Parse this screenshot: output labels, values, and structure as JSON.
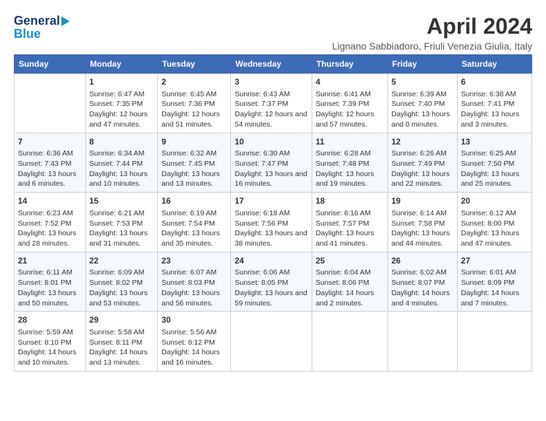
{
  "header": {
    "logo_line1": "General",
    "logo_line2": "Blue",
    "title": "April 2024",
    "subtitle": "Lignano Sabbiadoro, Friuli Venezia Giulia, Italy"
  },
  "columns": [
    "Sunday",
    "Monday",
    "Tuesday",
    "Wednesday",
    "Thursday",
    "Friday",
    "Saturday"
  ],
  "weeks": [
    [
      {
        "day": "",
        "sunrise": "",
        "sunset": "",
        "daylight": ""
      },
      {
        "day": "1",
        "sunrise": "Sunrise: 6:47 AM",
        "sunset": "Sunset: 7:35 PM",
        "daylight": "Daylight: 12 hours and 47 minutes."
      },
      {
        "day": "2",
        "sunrise": "Sunrise: 6:45 AM",
        "sunset": "Sunset: 7:36 PM",
        "daylight": "Daylight: 12 hours and 51 minutes."
      },
      {
        "day": "3",
        "sunrise": "Sunrise: 6:43 AM",
        "sunset": "Sunset: 7:37 PM",
        "daylight": "Daylight: 12 hours and 54 minutes."
      },
      {
        "day": "4",
        "sunrise": "Sunrise: 6:41 AM",
        "sunset": "Sunset: 7:39 PM",
        "daylight": "Daylight: 12 hours and 57 minutes."
      },
      {
        "day": "5",
        "sunrise": "Sunrise: 6:39 AM",
        "sunset": "Sunset: 7:40 PM",
        "daylight": "Daylight: 13 hours and 0 minutes."
      },
      {
        "day": "6",
        "sunrise": "Sunrise: 6:38 AM",
        "sunset": "Sunset: 7:41 PM",
        "daylight": "Daylight: 13 hours and 3 minutes."
      }
    ],
    [
      {
        "day": "7",
        "sunrise": "Sunrise: 6:36 AM",
        "sunset": "Sunset: 7:43 PM",
        "daylight": "Daylight: 13 hours and 6 minutes."
      },
      {
        "day": "8",
        "sunrise": "Sunrise: 6:34 AM",
        "sunset": "Sunset: 7:44 PM",
        "daylight": "Daylight: 13 hours and 10 minutes."
      },
      {
        "day": "9",
        "sunrise": "Sunrise: 6:32 AM",
        "sunset": "Sunset: 7:45 PM",
        "daylight": "Daylight: 13 hours and 13 minutes."
      },
      {
        "day": "10",
        "sunrise": "Sunrise: 6:30 AM",
        "sunset": "Sunset: 7:47 PM",
        "daylight": "Daylight: 13 hours and 16 minutes."
      },
      {
        "day": "11",
        "sunrise": "Sunrise: 6:28 AM",
        "sunset": "Sunset: 7:48 PM",
        "daylight": "Daylight: 13 hours and 19 minutes."
      },
      {
        "day": "12",
        "sunrise": "Sunrise: 6:26 AM",
        "sunset": "Sunset: 7:49 PM",
        "daylight": "Daylight: 13 hours and 22 minutes."
      },
      {
        "day": "13",
        "sunrise": "Sunrise: 6:25 AM",
        "sunset": "Sunset: 7:50 PM",
        "daylight": "Daylight: 13 hours and 25 minutes."
      }
    ],
    [
      {
        "day": "14",
        "sunrise": "Sunrise: 6:23 AM",
        "sunset": "Sunset: 7:52 PM",
        "daylight": "Daylight: 13 hours and 28 minutes."
      },
      {
        "day": "15",
        "sunrise": "Sunrise: 6:21 AM",
        "sunset": "Sunset: 7:53 PM",
        "daylight": "Daylight: 13 hours and 31 minutes."
      },
      {
        "day": "16",
        "sunrise": "Sunrise: 6:19 AM",
        "sunset": "Sunset: 7:54 PM",
        "daylight": "Daylight: 13 hours and 35 minutes."
      },
      {
        "day": "17",
        "sunrise": "Sunrise: 6:18 AM",
        "sunset": "Sunset: 7:56 PM",
        "daylight": "Daylight: 13 hours and 38 minutes."
      },
      {
        "day": "18",
        "sunrise": "Sunrise: 6:16 AM",
        "sunset": "Sunset: 7:57 PM",
        "daylight": "Daylight: 13 hours and 41 minutes."
      },
      {
        "day": "19",
        "sunrise": "Sunrise: 6:14 AM",
        "sunset": "Sunset: 7:58 PM",
        "daylight": "Daylight: 13 hours and 44 minutes."
      },
      {
        "day": "20",
        "sunrise": "Sunrise: 6:12 AM",
        "sunset": "Sunset: 8:00 PM",
        "daylight": "Daylight: 13 hours and 47 minutes."
      }
    ],
    [
      {
        "day": "21",
        "sunrise": "Sunrise: 6:11 AM",
        "sunset": "Sunset: 8:01 PM",
        "daylight": "Daylight: 13 hours and 50 minutes."
      },
      {
        "day": "22",
        "sunrise": "Sunrise: 6:09 AM",
        "sunset": "Sunset: 8:02 PM",
        "daylight": "Daylight: 13 hours and 53 minutes."
      },
      {
        "day": "23",
        "sunrise": "Sunrise: 6:07 AM",
        "sunset": "Sunset: 8:03 PM",
        "daylight": "Daylight: 13 hours and 56 minutes."
      },
      {
        "day": "24",
        "sunrise": "Sunrise: 6:06 AM",
        "sunset": "Sunset: 8:05 PM",
        "daylight": "Daylight: 13 hours and 59 minutes."
      },
      {
        "day": "25",
        "sunrise": "Sunrise: 6:04 AM",
        "sunset": "Sunset: 8:06 PM",
        "daylight": "Daylight: 14 hours and 2 minutes."
      },
      {
        "day": "26",
        "sunrise": "Sunrise: 6:02 AM",
        "sunset": "Sunset: 8:07 PM",
        "daylight": "Daylight: 14 hours and 4 minutes."
      },
      {
        "day": "27",
        "sunrise": "Sunrise: 6:01 AM",
        "sunset": "Sunset: 8:09 PM",
        "daylight": "Daylight: 14 hours and 7 minutes."
      }
    ],
    [
      {
        "day": "28",
        "sunrise": "Sunrise: 5:59 AM",
        "sunset": "Sunset: 8:10 PM",
        "daylight": "Daylight: 14 hours and 10 minutes."
      },
      {
        "day": "29",
        "sunrise": "Sunrise: 5:58 AM",
        "sunset": "Sunset: 8:11 PM",
        "daylight": "Daylight: 14 hours and 13 minutes."
      },
      {
        "day": "30",
        "sunrise": "Sunrise: 5:56 AM",
        "sunset": "Sunset: 8:12 PM",
        "daylight": "Daylight: 14 hours and 16 minutes."
      },
      {
        "day": "",
        "sunrise": "",
        "sunset": "",
        "daylight": ""
      },
      {
        "day": "",
        "sunrise": "",
        "sunset": "",
        "daylight": ""
      },
      {
        "day": "",
        "sunrise": "",
        "sunset": "",
        "daylight": ""
      },
      {
        "day": "",
        "sunrise": "",
        "sunset": "",
        "daylight": ""
      }
    ]
  ]
}
